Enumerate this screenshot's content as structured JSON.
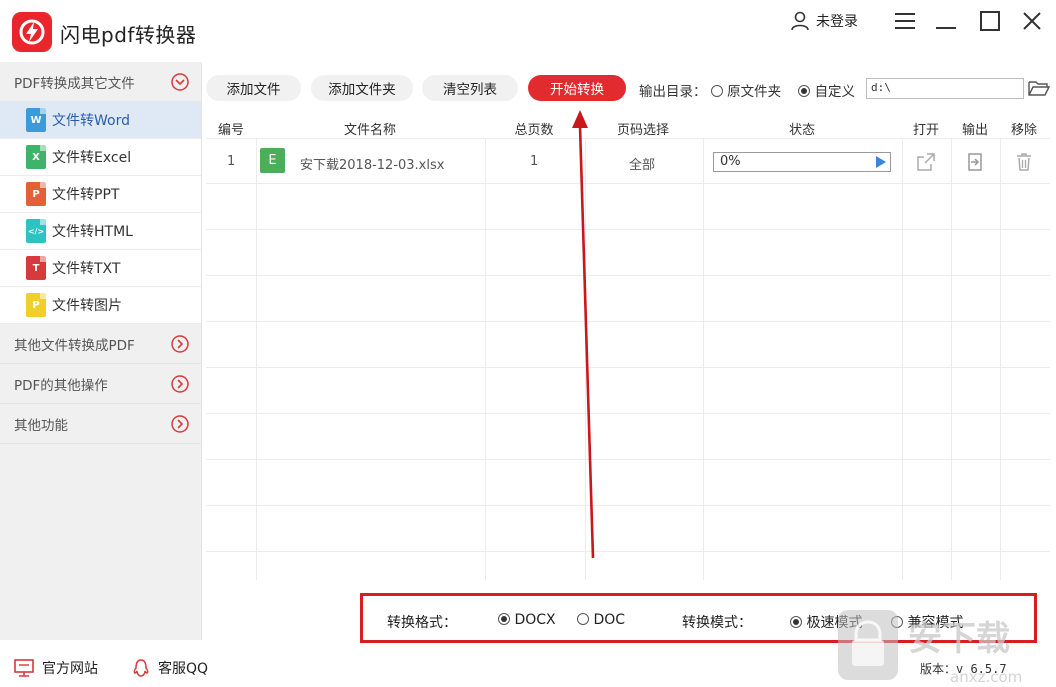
{
  "app": {
    "title": "闪电pdf转换器",
    "user_label": "未登录"
  },
  "sidebar": {
    "group_pdf_to_other": "PDF转换成其它文件",
    "items": [
      {
        "label": "文件转Word",
        "badge": "W",
        "color": "#3b9bd8"
      },
      {
        "label": "文件转Excel",
        "badge": "X",
        "color": "#3fb36a"
      },
      {
        "label": "文件转PPT",
        "badge": "P",
        "color": "#e2603a"
      },
      {
        "label": "文件转HTML",
        "badge": "</>",
        "color": "#2ec2c2"
      },
      {
        "label": "文件转TXT",
        "badge": "T",
        "color": "#d8393b"
      },
      {
        "label": "文件转图片",
        "badge": "P",
        "color": "#f0cf2a"
      }
    ],
    "group_other_to_pdf": "其他文件转换成PDF",
    "group_pdf_ops": "PDF的其他操作",
    "group_other": "其他功能"
  },
  "toolbar": {
    "add_file": "添加文件",
    "add_folder": "添加文件夹",
    "clear_list": "清空列表",
    "start": "开始转换",
    "output_label": "输出目录：",
    "option_original": "原文件夹",
    "option_custom": "自定义",
    "path_value": "d:\\"
  },
  "table": {
    "headers": [
      "编号",
      "文件名称",
      "总页数",
      "页码选择",
      "状态",
      "打开",
      "输出",
      "移除"
    ],
    "rows": [
      {
        "index": "1",
        "type_badge": "E",
        "filename": "安下载2018-12-03.xlsx",
        "pages": "1",
        "range": "全部",
        "progress": "0%"
      }
    ]
  },
  "settings": {
    "format_label": "转换格式：",
    "format_docx": "DOCX",
    "format_doc": "DOC",
    "mode_label": "转换模式：",
    "mode_fast": "极速模式",
    "mode_compat": "兼容模式"
  },
  "footer": {
    "website": "官方网站",
    "qq": "客服QQ",
    "version": "版本：v 6.5.7"
  },
  "watermark": {
    "text": "安下载",
    "sub": "anxz.com"
  },
  "colors": {
    "brand_red": "#e22b2f",
    "accent_blue": "#3b86d8",
    "active_bg": "#dfe9f5"
  }
}
